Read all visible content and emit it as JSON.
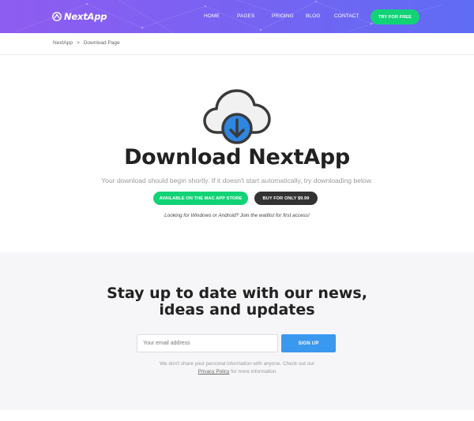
{
  "header": {
    "logo_text": "NextApp",
    "nav": [
      {
        "label": "HOME"
      },
      {
        "label": "PAGES"
      },
      {
        "label": "PRICING"
      },
      {
        "label": "BLOG"
      },
      {
        "label": "CONTACT"
      }
    ],
    "cta_label": "TRY FOR FREE"
  },
  "breadcrumb": {
    "root": "NextApp",
    "separator": ">",
    "current": "Download Page"
  },
  "hero": {
    "icon": "cloud-download-icon",
    "title": "Download NextApp",
    "subtitle": "Your download should begin shortly. If it doesn't start automatically, try downloading below.",
    "mac_button": "AVAILABLE ON THE MAC APP STORE",
    "buy_button": "BUY FOR ONLY $9.99",
    "note": "Looking for Windows or Android? Join the waitlist for first access!"
  },
  "newsletter": {
    "title_line1": "Stay up to date with our news,",
    "title_line2": "ideas and updates",
    "email_placeholder": "Your email address",
    "signup_label": "SIGN UP",
    "note_line1": "We don't share your personal information with anyone. Check out our",
    "privacy_link": "Privacy Policy",
    "note_suffix": "for more information"
  },
  "colors": {
    "header_gradient_start": "#8e5cf0",
    "header_gradient_end": "#5f6cf4",
    "green": "#11d376",
    "dark_button": "#333333",
    "blue_button": "#3a98ef",
    "cloud_arrow": "#2f86e0"
  }
}
